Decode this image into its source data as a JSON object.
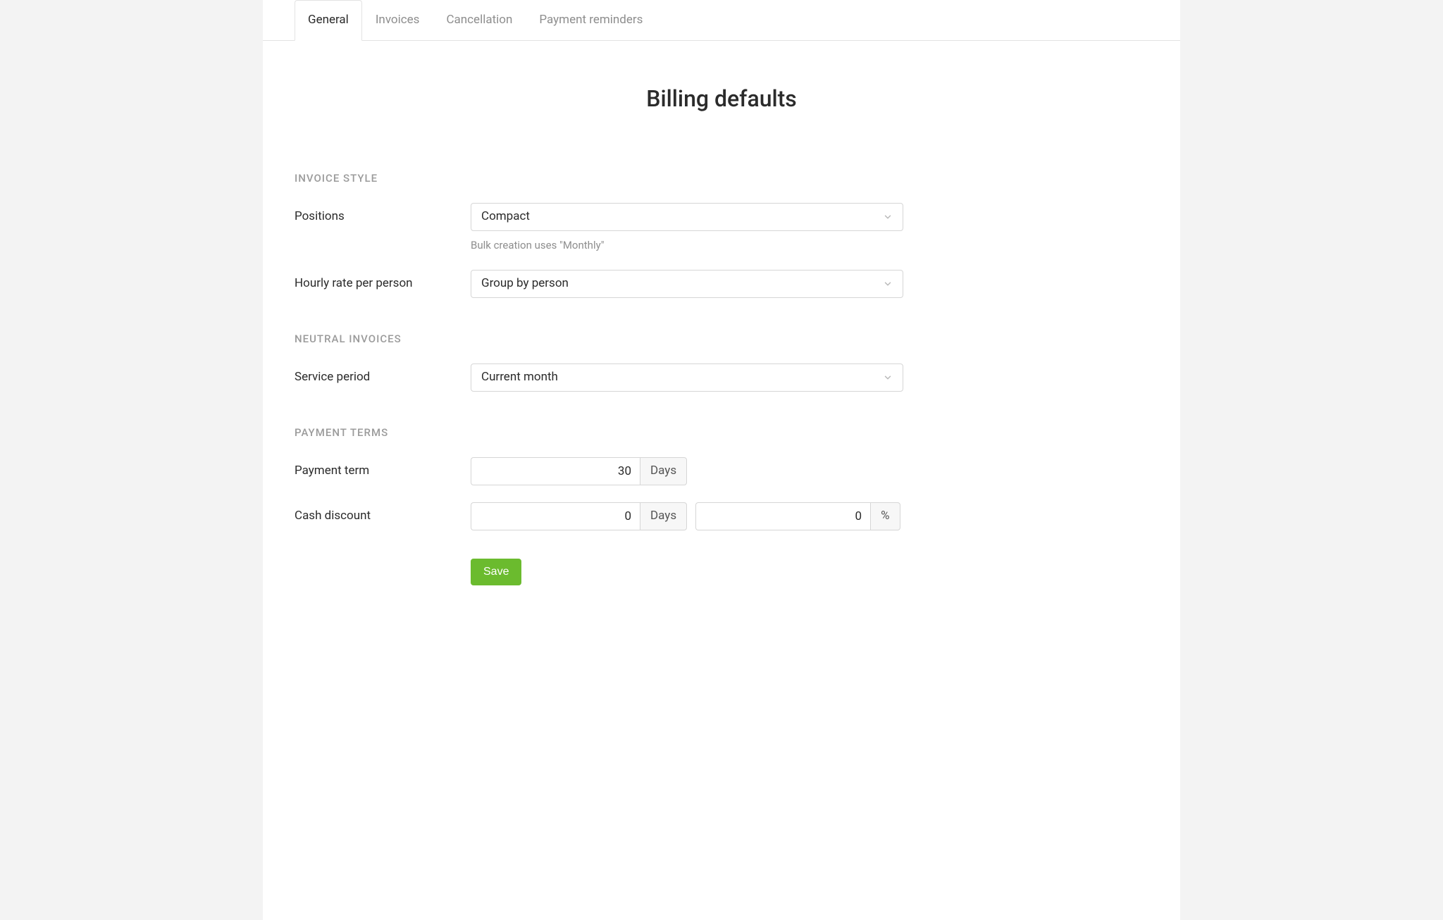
{
  "tabs": {
    "general": "General",
    "invoices": "Invoices",
    "cancellation": "Cancellation",
    "payment_reminders": "Payment reminders"
  },
  "page_title": "Billing defaults",
  "sections": {
    "invoice_style": {
      "heading": "INVOICE STYLE",
      "positions": {
        "label": "Positions",
        "value": "Compact",
        "help": "Bulk creation uses \"Monthly\""
      },
      "hourly_rate": {
        "label": "Hourly rate per person",
        "value": "Group by person"
      }
    },
    "neutral_invoices": {
      "heading": "NEUTRAL INVOICES",
      "service_period": {
        "label": "Service period",
        "value": "Current month"
      }
    },
    "payment_terms": {
      "heading": "PAYMENT TERMS",
      "payment_term": {
        "label": "Payment term",
        "value": "30",
        "unit": "Days"
      },
      "cash_discount": {
        "label": "Cash discount",
        "days_value": "0",
        "days_unit": "Days",
        "percent_value": "0",
        "percent_unit": "%"
      }
    }
  },
  "save_label": "Save"
}
